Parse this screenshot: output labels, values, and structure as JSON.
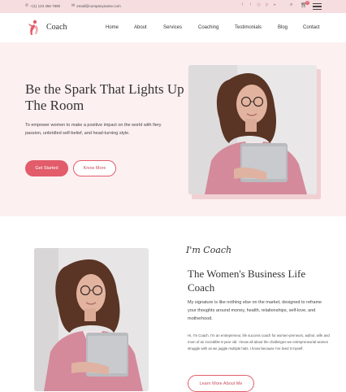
{
  "topbar": {
    "phone": "+(1) 123 456 7890",
    "email": "email@companyname.com",
    "socials": [
      "facebook-icon",
      "twitter-icon",
      "instagram-icon",
      "pinterest-icon",
      "youtube-icon"
    ],
    "cart_count": "0"
  },
  "header": {
    "brand": "Coach",
    "nav": [
      "Home",
      "About",
      "Services",
      "Coaching",
      "Testimonials",
      "Blog",
      "Contact"
    ]
  },
  "hero": {
    "title": "Be the Spark That Lights Up The Room",
    "text": "To empower women to make a positive impact on the world with fiery passion, unbridled self-belief, and head-turning style.",
    "primary_button": "Get Started",
    "secondary_button": "Know More"
  },
  "about": {
    "script": "I'm Coach",
    "title": "The Women's Business Life Coach",
    "text": "My signature is like nothing else on the market, designed to reframe your thoughts around money, health, relationships, self-love, and motherhood.",
    "small_text": "Hi, I'm Coach. I'm an entrepreneur, life success coach for women-preneurs, author, wife and mom of an incredible 6-year old. I know all about the challenges we entrepreneurial women struggle with as we juggle multiple hats. I know because I've lived it myself.",
    "button": "Learn More About Me"
  },
  "colors": {
    "accent": "#e25c6a",
    "hero_bg": "#fdf0f1",
    "topbar_bg": "#f6dde0"
  }
}
